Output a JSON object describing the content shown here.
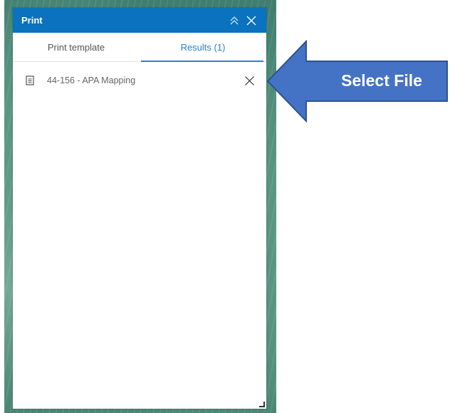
{
  "panel": {
    "title": "Print",
    "collapse_icon": "double-chevron-up-icon",
    "close_icon": "close-icon"
  },
  "tabs": [
    {
      "label": "Print template",
      "active": false
    },
    {
      "label": "Results (1)",
      "active": true
    }
  ],
  "results": [
    {
      "label": "44-156 - APA Mapping",
      "icon": "document-icon",
      "remove_icon": "close-icon"
    }
  ],
  "callout": {
    "label": "Select File",
    "fill_color": "#4472c4",
    "border_color": "#2f528f"
  },
  "colors": {
    "header": "#0a72be",
    "active_tab": "#2b7fd1"
  }
}
